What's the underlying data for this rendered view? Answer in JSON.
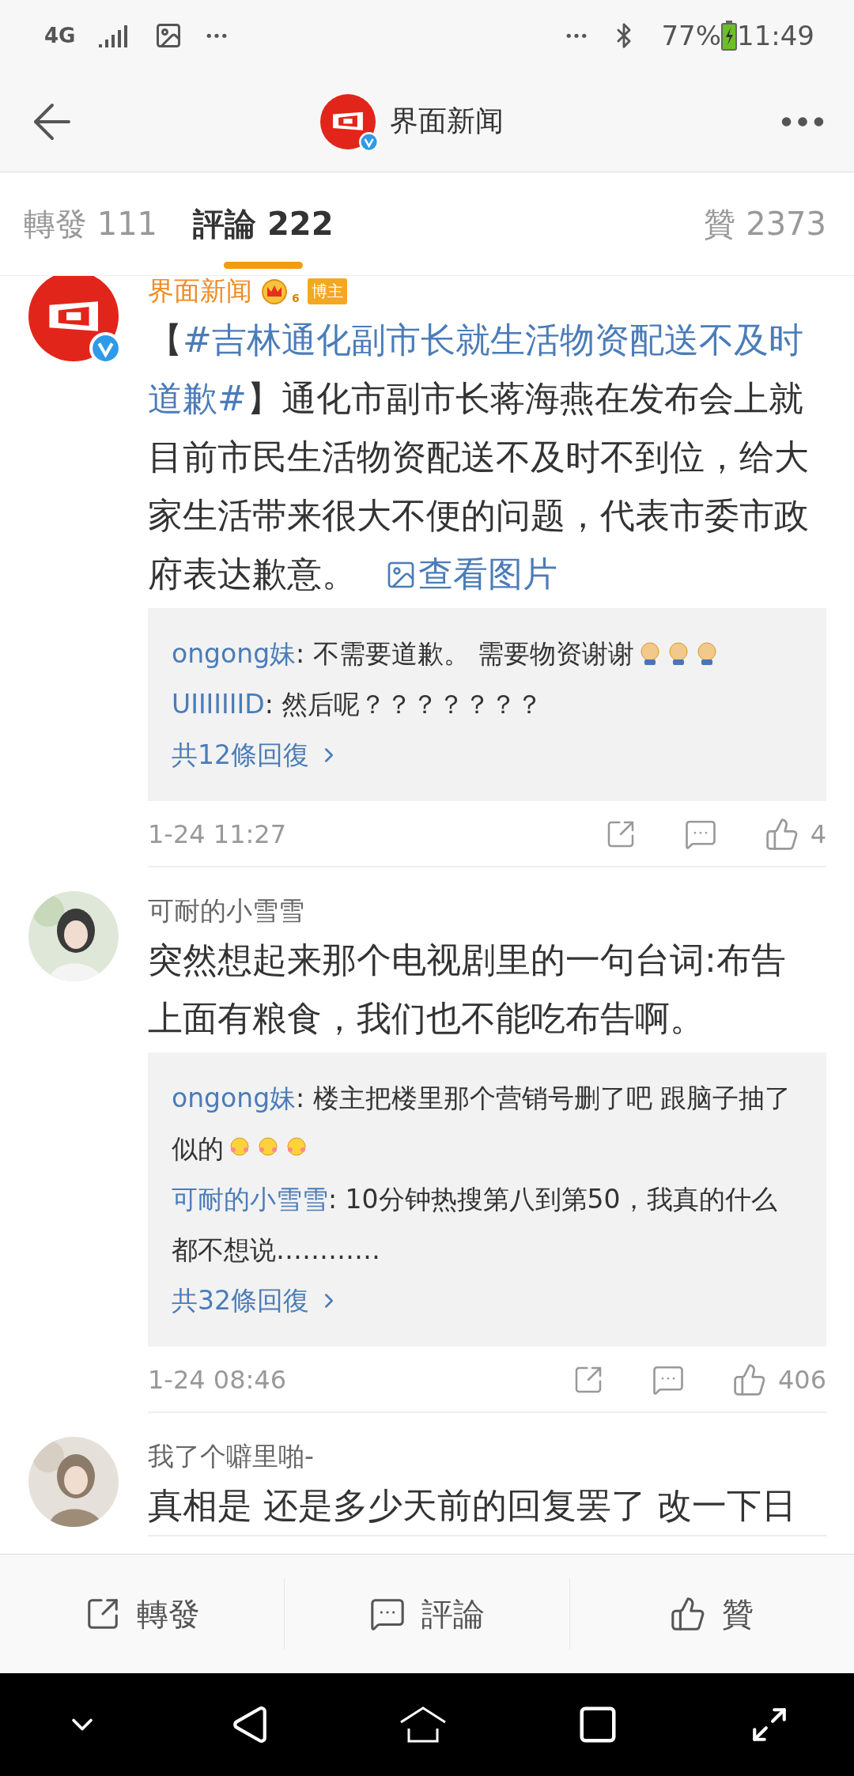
{
  "status_bar": {
    "network": "4G",
    "battery": "77%",
    "time": "11:49"
  },
  "header": {
    "title": "界面新闻",
    "verified": true
  },
  "tabs": [
    {
      "label": "轉發 111",
      "selected": false
    },
    {
      "label": "評論 222",
      "selected": true
    },
    {
      "label": "贊 2373",
      "selected": false
    }
  ],
  "comments": [
    {
      "author": "界面新闻",
      "avatar": {
        "kind": "logo"
      },
      "verified": true,
      "member_rank": "6",
      "role_badge": "博主",
      "text": [
        {
          "kind": "plain",
          "text": "【"
        },
        {
          "kind": "topic",
          "text": "#吉林通化副市长就生活物资配送不及时道歉#"
        },
        {
          "kind": "plain",
          "text": "】通化市副市长蒋海燕在发布会上就目前市民生活物资配送不及时不到位，给大家生活带来很大不便的问题，代表市委市政府表达歉意。"
        }
      ],
      "image_link": "查看图片",
      "replies": [
        {
          "author": "ongong妹",
          "text": ": 不需要道歉。 需要物资谢谢",
          "emojis": [
            {
              "kind": "sweat"
            },
            {
              "kind": "sweat"
            },
            {
              "kind": "sweat"
            }
          ]
        },
        {
          "author": "UIIIIIIID",
          "text": ": 然后呢？？？？？？？"
        }
      ],
      "more_replies": "共12條回復",
      "time": "1-24 11:27",
      "likes": "4"
    },
    {
      "author": "可耐的小雪雪",
      "avatar": {
        "kind": "picture"
      },
      "text": [
        {
          "kind": "plain",
          "text": "突然想起来那个电视剧里的一句台词:布告上面有粮食，我们也不能吃布告啊。"
        }
      ],
      "replies": [
        {
          "author": "ongong妹",
          "text": ": 楼主把楼里那个营销号删了吧  跟脑子抽了似的",
          "emojis": [
            {
              "kind": "blush"
            },
            {
              "kind": "blush"
            },
            {
              "kind": "blush"
            }
          ]
        },
        {
          "author": "可耐的小雪雪",
          "text": ": 10分钟热搜第八到第50，我真的什么都不想说…………"
        }
      ],
      "more_replies": "共32條回復",
      "time": "1-24 08:46",
      "likes": "406"
    },
    {
      "author": "我了个噼里啪-",
      "avatar": {
        "kind": "picture"
      },
      "text": [
        {
          "kind": "plain",
          "text": "真相是 还是多少天前的回复罢了 改一下日"
        }
      ]
    }
  ],
  "action_bar": [
    {
      "kind": "repost",
      "label": "轉發"
    },
    {
      "kind": "comment",
      "label": "評論"
    },
    {
      "kind": "like",
      "label": "贊"
    }
  ]
}
